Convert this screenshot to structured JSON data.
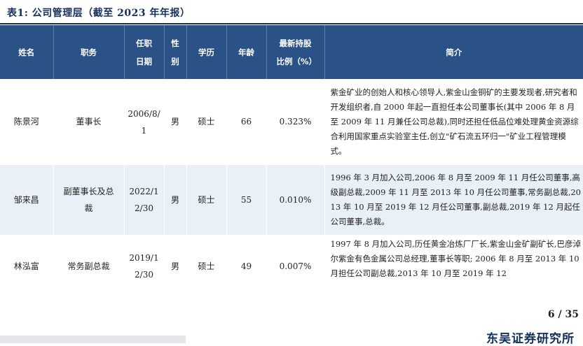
{
  "caption": "表1:  公司管理层（截至 2023 年年报）",
  "table": {
    "headers": [
      "姓名",
      "职务",
      "任职日期",
      "性别",
      "学历",
      "年龄",
      "最新持股比例（%）",
      "简介"
    ],
    "rows": [
      {
        "name": "陈景河",
        "title": "董事长",
        "date": "2006/8/1",
        "gender": "男",
        "education": "硕士",
        "age": "66",
        "share": "0.323%",
        "bio": "紫金矿业的创始人和核心领导人,紫金山金铜矿的主要发现者,研究者和开发组织者,自 2000 年起一直担任本公司董事长(其中 2006 年 8 月至 2009 年 11 月兼任公司总裁),同时还担任低品位难处理黄金资源综合利用国家重点实验室主任,创立\"矿石流五环归一\"矿业工程管理模式。"
      },
      {
        "name": "邹来昌",
        "title": "副董事长及总裁",
        "date": "2022/12/30",
        "gender": "男",
        "education": "硕士",
        "age": "55",
        "share": "0.010%",
        "bio": "1996 年 3 月加入公司,2006 年 8 月至 2009 年 11 月任公司董事,高级副总裁,2009 年 11 月至 2013 年 10 月任公司董事,常务副总裁,2013 年 10 月至 2019 年 12 月任公司董事,副总裁,2019 年 12 月起任公司董事,总裁。"
      },
      {
        "name": "林泓富",
        "title": "常务副总裁",
        "date": "2019/12/30",
        "gender": "男",
        "education": "硕士",
        "age": "49",
        "share": "0.007%",
        "bio": "1997 年 8 月加入公司,历任黄金冶炼厂厂长,紫金山金矿副矿长,巴彦淖尔紫金有色金属公司总经理,董事长等职; 2006 年 8 月至 2013 年 10 月担任公司副总裁,2013 年 10 月至 2019 年 12"
      }
    ]
  },
  "footer": {
    "page": "6 / 35",
    "brand": "东吴证券研究所"
  }
}
